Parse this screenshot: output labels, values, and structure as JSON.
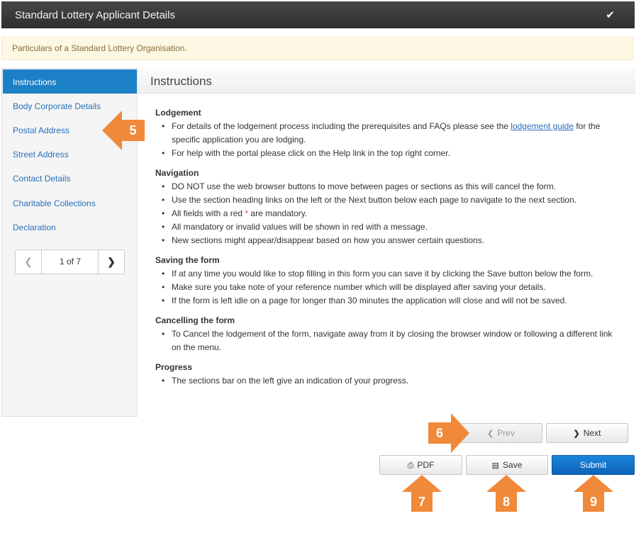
{
  "header": {
    "title": "Standard Lottery Applicant Details",
    "check_icon": "check-icon"
  },
  "alert": {
    "text": "Particulars of a Standard Lottery Organisation."
  },
  "sidebar": {
    "items": [
      {
        "label": "Instructions",
        "active": true
      },
      {
        "label": "Body Corporate Details"
      },
      {
        "label": "Postal Address"
      },
      {
        "label": "Street Address"
      },
      {
        "label": "Contact Details"
      },
      {
        "label": "Charitable Collections"
      },
      {
        "label": "Declaration"
      }
    ],
    "pager": {
      "text": "1 of 7"
    }
  },
  "panel": {
    "title": "Instructions",
    "sections": {
      "lodgement": {
        "heading": "Lodgement",
        "b1_pre": "For details of the lodgement process including the prerequisites and FAQs please see the ",
        "b1_link": "lodgement guide",
        "b1_post": " for the specific application you are lodging.",
        "b2": "For help with the portal please click on the Help link in the top right corner."
      },
      "navigation": {
        "heading": "Navigation",
        "b1": "DO NOT use the web browser buttons to move between pages or sections as this will cancel the form.",
        "b2": "Use the section heading links on the left or the Next button below each page to navigate to the next section.",
        "b3_pre": "All fields with a red ",
        "b3_star": "*",
        "b3_post": " are mandatory.",
        "b4": "All mandatory or invalid values will be shown in red with a message.",
        "b5": "New sections might appear/disappear based on how you answer certain questions."
      },
      "saving": {
        "heading": "Saving the form",
        "b1": "If at any time you would like to stop filling in this form you can save it by clicking the Save button below the form.",
        "b2": "Make sure you take note of your reference number which will be displayed after saving your details.",
        "b3": "If the form is left idle on a page for longer than 30 minutes the application will close and will not be saved."
      },
      "cancelling": {
        "heading": "Cancelling the form",
        "b1": "To Cancel the lodgement of the form, navigate away from it by closing the browser window or following a different link on the menu."
      },
      "progress": {
        "heading": "Progress",
        "b1": "The sections bar on the left give an indication of your progress."
      }
    }
  },
  "buttons": {
    "prev": "Prev",
    "next": "Next",
    "pdf": "PDF",
    "save": "Save",
    "submit": "Submit"
  },
  "callouts": {
    "c5": "5",
    "c6": "6",
    "c7": "7",
    "c8": "8",
    "c9": "9"
  },
  "colors": {
    "accent": "#1c80c6",
    "callout": "#f0893a",
    "submit": "#0d62b8"
  }
}
